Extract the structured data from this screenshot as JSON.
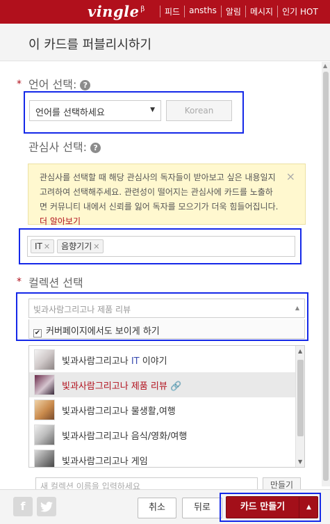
{
  "topbar": {
    "logo": "vingle",
    "logo_sup": "β",
    "nav": [
      "피드",
      "ansths",
      "알림",
      "메시지",
      "인기 HOT"
    ]
  },
  "modal": {
    "title": "이 카드를 퍼블리시하기"
  },
  "language": {
    "label": "언어 선택:",
    "select_value": "언어를 선택하세요",
    "button_label": "Korean"
  },
  "interest": {
    "label": "관심사 선택:",
    "notice_text": "관심사를 선택할 때 해당 관심사의 독자들이 받아보고 싶은 내용일지 고려하여 선택해주세요. 관련성이 떨어지는 관심사에 카드를 노출하면 커뮤니티 내에서 신뢰를 잃어 독자를 모으기가 더욱 힘들어집니다.",
    "notice_link": "더 알아보기",
    "tags": [
      "IT",
      "음향기기"
    ]
  },
  "collection": {
    "label": "컬렉션 선택",
    "select_placeholder": "빛과사람그리고나 제품 리뷰",
    "cover_label": "커버페이지에서도 보이게 하기",
    "items": [
      {
        "prefix": "빛과사람그리고나 ",
        "highlight": "IT",
        "suffix": " 이야기"
      },
      {
        "prefix": "빛과사람그리고나 제품 리뷰",
        "highlight": "",
        "suffix": ""
      },
      {
        "prefix": "빛과사람그리고나 물생활,여행",
        "highlight": "",
        "suffix": ""
      },
      {
        "prefix": "빛과사람그리고나 음식/영화/여행",
        "highlight": "",
        "suffix": ""
      },
      {
        "prefix": "빛과사람그리고나 게임",
        "highlight": "",
        "suffix": ""
      }
    ],
    "new_placeholder": "새 컬렉션 이름을 입력하세요",
    "new_button": "만들기"
  },
  "footer": {
    "facebook": "f",
    "cancel": "취소",
    "back": "뒤로",
    "create": "카드 만들기"
  },
  "colors": {
    "brand_red": "#b1101c",
    "highlight_blue": "#1428e8",
    "notice_bg": "#fff8cf"
  }
}
